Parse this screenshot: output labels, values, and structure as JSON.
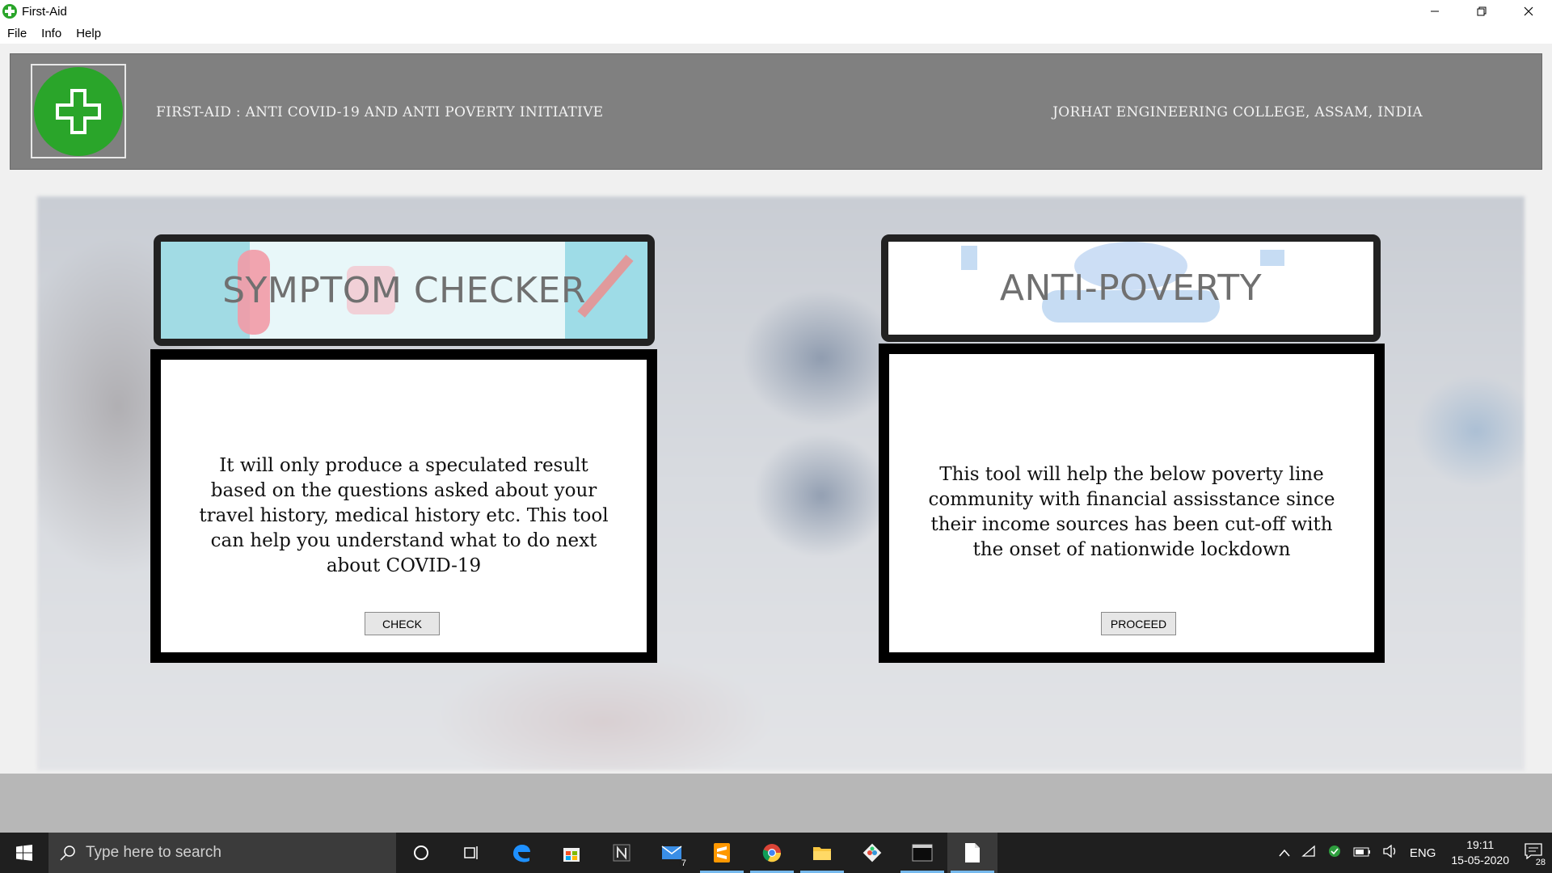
{
  "window": {
    "title": "First-Aid",
    "minimize_glyph": "—",
    "restore_glyph": "❐",
    "close_glyph": "✕"
  },
  "menu": [
    "File",
    "Info",
    "Help"
  ],
  "header": {
    "left_text": "FIRST-AID : ANTI COVID-19 AND ANTI POVERTY INITIATIVE",
    "right_text": "JORHAT ENGINEERING COLLEGE, ASSAM, INDIA",
    "logo_icon": "medical-cross-icon",
    "logo_color": "#2aa52a"
  },
  "cards": {
    "symptom": {
      "banner_title": "SYMPTOM CHECKER",
      "description": "It will only produce a speculated result based on the questions asked about your travel history, medical history etc. This tool can help you understand what to do next about COVID-19",
      "button_label": "CHECK"
    },
    "poverty": {
      "banner_title": "ANTI-POVERTY",
      "description": "This tool will help the below poverty line community with financial assisstance since their income sources has been cut-off with the onset of nationwide lockdown",
      "button_label": "PROCEED"
    }
  },
  "taskbar": {
    "search_placeholder": "Type here to search",
    "mail_badge": "7",
    "language": "ENG",
    "time": "19:11",
    "date": "15-05-2020",
    "notification_count": "28",
    "icons": [
      "windows-start-icon",
      "search-icon",
      "cortana-icon",
      "task-view-icon",
      "edge-icon",
      "store-icon",
      "notion-icon",
      "mail-icon",
      "sublime-icon",
      "chrome-icon",
      "file-explorer-icon",
      "git-icon",
      "terminal-icon",
      "notepad-icon"
    ]
  }
}
